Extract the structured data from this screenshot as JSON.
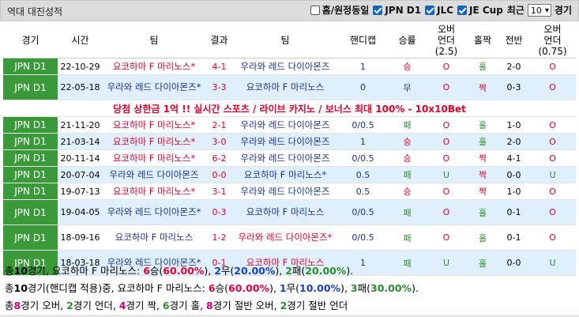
{
  "header": {
    "title": "역대 대진성적",
    "options": [
      {
        "label": "홈/원정동일",
        "checked": false
      },
      {
        "label": "JPN D1",
        "checked": true
      },
      {
        "label": "JLC",
        "checked": true
      },
      {
        "label": "JE Cup",
        "checked": true
      }
    ],
    "recent_label": "최근",
    "recent_value": "10",
    "games_label": "경기"
  },
  "columns": [
    "경기",
    "시간",
    "팀",
    "결과",
    "팀",
    "핸디캡",
    "승률",
    "오버\n언더\n(2.5)",
    "홀짝",
    "전반",
    "오버\n언더\n(0.75)"
  ],
  "rows": [
    {
      "league": "JPN D1",
      "date": "22-10-29",
      "home": "요코하마 F 마리노스*",
      "home_color": "red",
      "score": "4-1",
      "away": "우라와 레드 다이아몬즈",
      "away_color": "navy",
      "hcap": "1",
      "hcap_color": "navy",
      "result": "승",
      "result_color": "red",
      "ou": "O",
      "ou_color": "red",
      "oe": "홀",
      "oe_color": "green",
      "half": "2-0",
      "ou2": "O",
      "ou2_color": "red",
      "alt": false
    },
    {
      "league": "JPN D1",
      "date": "22-05-18",
      "home": "우라와 레드 다이아몬즈*",
      "home_color": "navy",
      "score": "3-3",
      "away": "요코하마 F 마리노스",
      "away_color": "navy",
      "hcap": "0",
      "hcap_color": "navy",
      "result": "무",
      "result_color": "navy",
      "ou": "O",
      "ou_color": "red",
      "oe": "짝",
      "oe_color": "pink",
      "half": "0-3",
      "ou2": "O",
      "ou2_color": "red",
      "alt": true,
      "tall": true
    }
  ],
  "ad_text": "당첨 상한금 1억 !! 실시간 스포츠 / 라이브 카지노 / 보너스 최대 100% - 10x10Bet",
  "rows2": [
    {
      "league": "JPN D1",
      "date": "21-11-20",
      "home": "요코하마 F 마리노스*",
      "home_color": "red",
      "score": "2-1",
      "away": "우라와 레드 다이아몬즈",
      "away_color": "navy",
      "hcap": "0/0.5",
      "hcap_color": "navy",
      "result": "패",
      "result_color": "green",
      "ou": "O",
      "ou_color": "red",
      "oe": "홀",
      "oe_color": "green",
      "half": "1-0",
      "ou2": "O",
      "ou2_color": "red",
      "alt": false
    },
    {
      "league": "JPN D1",
      "date": "21-03-14",
      "home": "요코하마 F 마리노스*",
      "home_color": "red",
      "score": "3-0",
      "away": "우라와 레드 다이아몬즈",
      "away_color": "navy",
      "hcap": "1",
      "hcap_color": "navy",
      "result": "승",
      "result_color": "red",
      "ou": "O",
      "ou_color": "red",
      "oe": "홀",
      "oe_color": "green",
      "half": "2-0",
      "ou2": "O",
      "ou2_color": "red",
      "alt": true
    },
    {
      "league": "JPN D1",
      "date": "20-11-14",
      "home": "요코하마 F 마리노스*",
      "home_color": "red",
      "score": "6-2",
      "away": "우라와 레드 다이아몬즈",
      "away_color": "navy",
      "hcap": "0/0.5",
      "hcap_color": "navy",
      "result": "승",
      "result_color": "red",
      "ou": "O",
      "ou_color": "red",
      "oe": "짝",
      "oe_color": "pink",
      "half": "4-1",
      "ou2": "O",
      "ou2_color": "red",
      "alt": false
    },
    {
      "league": "JPN D1",
      "date": "20-07-04",
      "home": "우라와 레드 다이아몬즈",
      "home_color": "navy",
      "score": "0-0",
      "away": "요코하마 F 마리노스*",
      "away_color": "navy",
      "hcap": "0.5",
      "hcap_color": "navy",
      "result": "패",
      "result_color": "green",
      "ou": "U",
      "ou_color": "green",
      "oe": "짝",
      "oe_color": "pink",
      "half": "0-0",
      "ou2": "U",
      "ou2_color": "green",
      "alt": true
    },
    {
      "league": "JPN D1",
      "date": "19-07-13",
      "home": "요코하마 F 마리노스*",
      "home_color": "red",
      "score": "3-1",
      "away": "우라와 레드 다이아몬즈",
      "away_color": "navy",
      "hcap": "0.5",
      "hcap_color": "navy",
      "result": "승",
      "result_color": "red",
      "ou": "O",
      "ou_color": "red",
      "oe": "짝",
      "oe_color": "pink",
      "half": "1-0",
      "ou2": "O",
      "ou2_color": "red",
      "alt": false
    },
    {
      "league": "JPN D1",
      "date": "19-04-05",
      "home": "우라와 레드 다이아몬즈*",
      "home_color": "navy",
      "score": "0-3",
      "away": "요코하마 F 마리노스",
      "away_color": "navy",
      "hcap": "0/0.5",
      "hcap_color": "navy",
      "result": "패",
      "result_color": "green",
      "ou": "O",
      "ou_color": "red",
      "oe": "홀",
      "oe_color": "green",
      "half": "0-1",
      "ou2": "O",
      "ou2_color": "red",
      "alt": true,
      "tall": true
    },
    {
      "league": "JPN D1",
      "date": "18-09-16",
      "home": "요코하마 F 마리노스",
      "home_color": "navy",
      "score": "1-2",
      "away": "우라와 레드 다이아몬즈*",
      "away_color": "red",
      "hcap": "0/0.5",
      "hcap_color": "navy",
      "result": "패",
      "result_color": "green",
      "ou": "O",
      "ou_color": "red",
      "oe": "홀",
      "oe_color": "green",
      "half": "0-1",
      "ou2": "O",
      "ou2_color": "red",
      "alt": false,
      "tall": true
    },
    {
      "league": "JPN D1",
      "date": "18-03-18",
      "home": "우라와 레드 다이아몬즈*",
      "home_color": "navy",
      "score": "0-1",
      "away": "요코하마 F 마리노스",
      "away_color": "red",
      "hcap": "1",
      "hcap_color": "navy",
      "result": "패",
      "result_color": "green",
      "ou": "U",
      "ou_color": "green",
      "oe": "홀",
      "oe_color": "green",
      "half": "0-0",
      "ou2": "U",
      "ou2_color": "green",
      "alt": true,
      "tall": true
    }
  ],
  "summary": {
    "line1": [
      {
        "t": "총"
      },
      {
        "t": "10",
        "c": "b"
      },
      {
        "t": "경기, 요코하마 F 마리노스: "
      },
      {
        "t": "6",
        "c": "rd"
      },
      {
        "t": "승("
      },
      {
        "t": "60.00%",
        "c": "rd"
      },
      {
        "t": "), "
      },
      {
        "t": "2",
        "c": "bl"
      },
      {
        "t": "무("
      },
      {
        "t": "20.00%",
        "c": "bl"
      },
      {
        "t": "), "
      },
      {
        "t": "2",
        "c": "gr"
      },
      {
        "t": "패("
      },
      {
        "t": "20.00%",
        "c": "gr"
      },
      {
        "t": ")."
      }
    ],
    "line2": [
      {
        "t": "총"
      },
      {
        "t": "10",
        "c": "b"
      },
      {
        "t": "경기(핸디캡 적용)중, 요코하마 F 마리노스: "
      },
      {
        "t": "6",
        "c": "rd"
      },
      {
        "t": "승("
      },
      {
        "t": "60.00%",
        "c": "rd"
      },
      {
        "t": "), "
      },
      {
        "t": "1",
        "c": "bl"
      },
      {
        "t": "무("
      },
      {
        "t": "10.00%",
        "c": "bl"
      },
      {
        "t": "), "
      },
      {
        "t": "3",
        "c": "gr"
      },
      {
        "t": "패("
      },
      {
        "t": "30.00%",
        "c": "gr"
      },
      {
        "t": ")."
      }
    ],
    "line3": [
      {
        "t": "총"
      },
      {
        "t": "8",
        "c": "pk"
      },
      {
        "t": "경기 오버, "
      },
      {
        "t": "2",
        "c": "gr"
      },
      {
        "t": "경기 언더, "
      },
      {
        "t": "4",
        "c": "pk"
      },
      {
        "t": "경기 짝, "
      },
      {
        "t": "6",
        "c": "gr"
      },
      {
        "t": "경기 홀, "
      },
      {
        "t": "8",
        "c": "pk"
      },
      {
        "t": "경기 절반 오버, "
      },
      {
        "t": "2",
        "c": "gr"
      },
      {
        "t": "경기 절반 언더"
      }
    ]
  }
}
